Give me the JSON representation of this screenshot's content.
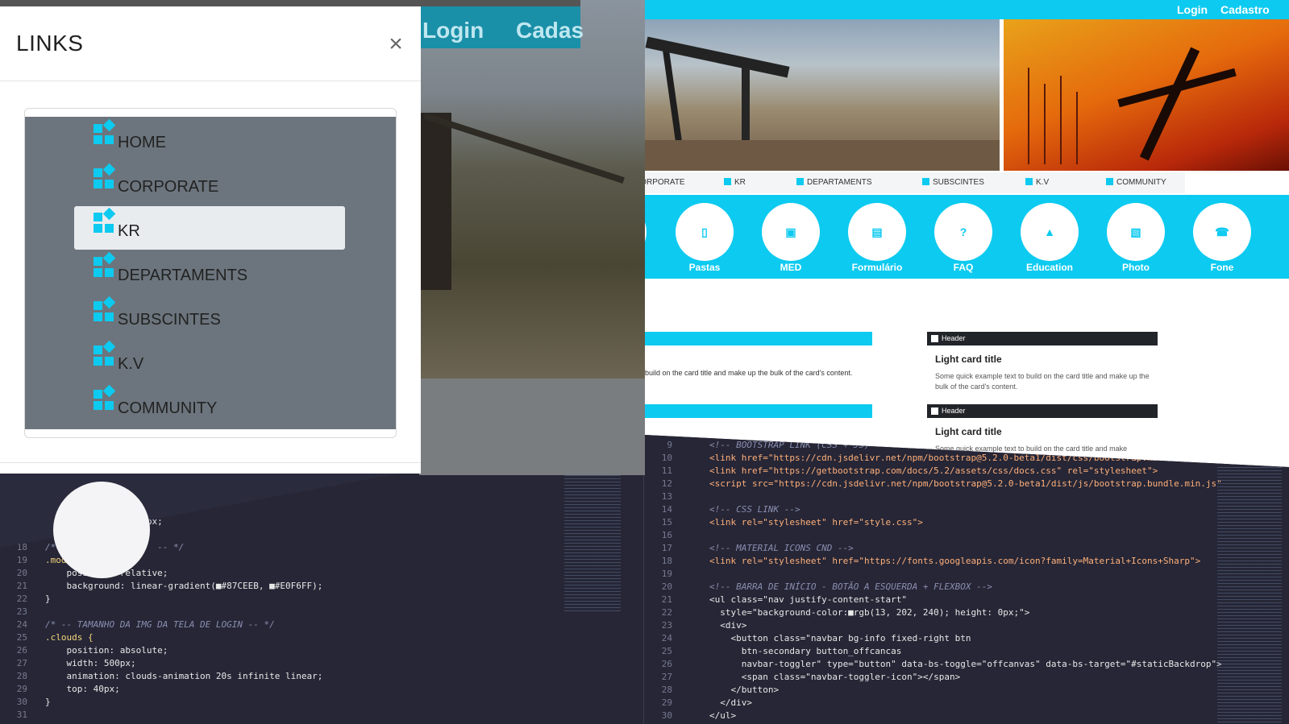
{
  "offcanvas": {
    "title": "LINKS",
    "close_icon": "close-icon",
    "items": [
      {
        "label": "HOME",
        "icon": "widgets-icon"
      },
      {
        "label": "CORPORATE",
        "icon": "widgets-icon"
      },
      {
        "label": "KR",
        "icon": "widgets-icon",
        "active": true
      },
      {
        "label": "DEPARTAMENTS",
        "icon": "widgets-icon"
      },
      {
        "label": "SUBSCINTES",
        "icon": "widgets-icon"
      },
      {
        "label": "K.V",
        "icon": "widgets-icon"
      },
      {
        "label": "COMMUNITY",
        "icon": "widgets-icon"
      }
    ]
  },
  "background_nav": {
    "login": "Login",
    "cadastro": "Cadas"
  },
  "site": {
    "topbar": {
      "login": "Login",
      "cadastro": "Cadastro"
    },
    "nav": [
      "CORPORATE",
      "KR",
      "DEPARTAMENTS",
      "SUBSCINTES",
      "K.V",
      "COMMUNITY"
    ],
    "circles": [
      {
        "label": "orite",
        "glyph": "+"
      },
      {
        "label": "Pastas",
        "glyph": "▯"
      },
      {
        "label": "MED",
        "glyph": "▣"
      },
      {
        "label": "Formulário",
        "glyph": "▤"
      },
      {
        "label": "FAQ",
        "glyph": "?"
      },
      {
        "label": "Education",
        "glyph": "▲"
      },
      {
        "label": "Photo",
        "glyph": "▧"
      },
      {
        "label": "Fone",
        "glyph": "☎"
      }
    ],
    "card_left_text": "build on the card title and make up the bulk of the card's content.",
    "cards": [
      {
        "header": "Header",
        "title": "Light card title",
        "body": "Some quick example text to build on the card title and make up the bulk of the card's content."
      },
      {
        "header": "Header",
        "title": "Light card title",
        "body": "Some quick example text to build on the card title and make"
      }
    ]
  },
  "editor_left": {
    "lines": [
      {
        "n": "",
        "text": "    0px 120px 0px 0px;"
      },
      {
        "n": "17",
        "text": ""
      },
      {
        "n": "18",
        "text": "/* -- TELA DE LOGIN  -- */"
      },
      {
        "n": "19",
        "text": ".modal_color {"
      },
      {
        "n": "20",
        "text": "    position: relative;"
      },
      {
        "n": "21",
        "text": "    background: linear-gradient(■#87CEEB, ■#E0F6FF);"
      },
      {
        "n": "22",
        "text": "}"
      },
      {
        "n": "23",
        "text": ""
      },
      {
        "n": "24",
        "text": "/* -- TAMANHO DA IMG DA TELA DE LOGIN -- */"
      },
      {
        "n": "25",
        "text": ".clouds {"
      },
      {
        "n": "26",
        "text": "    position: absolute;"
      },
      {
        "n": "27",
        "text": "    width: 500px;"
      },
      {
        "n": "28",
        "text": "    animation: clouds-animation 20s infinite linear;"
      },
      {
        "n": "29",
        "text": "    top: 40px;"
      },
      {
        "n": "30",
        "text": "}"
      },
      {
        "n": "31",
        "text": ""
      }
    ]
  },
  "editor_right": {
    "lines": [
      {
        "n": "9",
        "text": "<!-- BOOTSTRAP LINK (CSS + JS) -->"
      },
      {
        "n": "10",
        "text": "<link href=\"https://cdn.jsdelivr.net/npm/bootstrap@5.2.0-beta1/dist/css/bootstrap.min.css\""
      },
      {
        "n": "11",
        "text": "<link href=\"https://getbootstrap.com/docs/5.2/assets/css/docs.css\" rel=\"stylesheet\">"
      },
      {
        "n": "12",
        "text": "<script src=\"https://cdn.jsdelivr.net/npm/bootstrap@5.2.0-beta1/dist/js/bootstrap.bundle.min.js\""
      },
      {
        "n": "13",
        "text": ""
      },
      {
        "n": "14",
        "text": "<!-- CSS LINK -->"
      },
      {
        "n": "15",
        "text": "<link rel=\"stylesheet\" href=\"style.css\">"
      },
      {
        "n": "16",
        "text": ""
      },
      {
        "n": "17",
        "text": "<!-- MATERIAL ICONS CND -->"
      },
      {
        "n": "18",
        "text": "<link rel=\"stylesheet\" href=\"https://fonts.googleapis.com/icon?family=Material+Icons+Sharp\">"
      },
      {
        "n": "19",
        "text": ""
      },
      {
        "n": "20",
        "text": "<!-- BARRA DE INÍCIO - BOTÃO A ESQUERDA + FLEXBOX -->"
      },
      {
        "n": "21",
        "text": "<ul class=\"nav justify-content-start\""
      },
      {
        "n": "22",
        "text": "  style=\"background-color:■rgb(13, 202, 240); height: 0px;\">"
      },
      {
        "n": "23",
        "text": "  <div>"
      },
      {
        "n": "24",
        "text": "    <button class=\"navbar bg-info fixed-right btn"
      },
      {
        "n": "25",
        "text": "      btn-secondary button_offcancas"
      },
      {
        "n": "26",
        "text": "      navbar-toggler\" type=\"button\" data-bs-toggle=\"offcanvas\" data-bs-target=\"#staticBackdrop\">"
      },
      {
        "n": "27",
        "text": "      <span class=\"navbar-toggler-icon\"></span>"
      },
      {
        "n": "28",
        "text": "    </button>"
      },
      {
        "n": "29",
        "text": "  </div>"
      },
      {
        "n": "30",
        "text": "</ul>"
      },
      {
        "n": "31",
        "text": ""
      }
    ]
  },
  "colors": {
    "accent": "#0dcaf0",
    "menu_bg": "#6c757d",
    "editor_bg": "#262636"
  }
}
